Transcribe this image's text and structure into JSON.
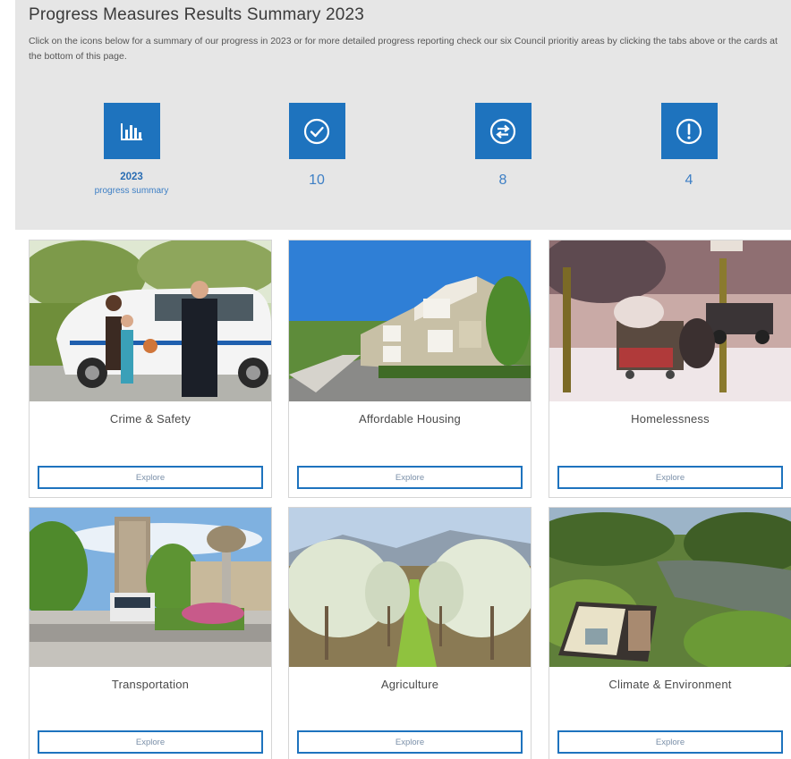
{
  "summary": {
    "title": "Progress Measures Results Summary 2023",
    "description": "Click on the icons below for a summary of our progress in 2023 or for more detailed progress reporting check our six Council prioritiy areas by clicking the tabs above or the cards at the bottom of this page.",
    "stats": [
      {
        "icon": "bar-chart-icon",
        "year": "2023",
        "subtitle": "progress summary"
      },
      {
        "icon": "check-circle-icon",
        "value": "10"
      },
      {
        "icon": "exchange-circle-icon",
        "value": "8"
      },
      {
        "icon": "exclamation-circle-icon",
        "value": "4"
      }
    ],
    "accent_color": "#1e73be"
  },
  "cards": [
    {
      "title": "Crime & Safety",
      "button": "Explore",
      "image": "police-officer-with-family-photo"
    },
    {
      "title": "Affordable Housing",
      "button": "Explore",
      "image": "townhouses-photo"
    },
    {
      "title": "Homelessness",
      "button": "Explore",
      "image": "snowy-street-cart-photo"
    },
    {
      "title": "Transportation",
      "button": "Explore",
      "image": "bus-roundabout-photo"
    },
    {
      "title": "Agriculture",
      "button": "Explore",
      "image": "orchard-rows-photo"
    },
    {
      "title": "Climate & Environment",
      "button": "Explore",
      "image": "wetland-sign-photo"
    }
  ]
}
